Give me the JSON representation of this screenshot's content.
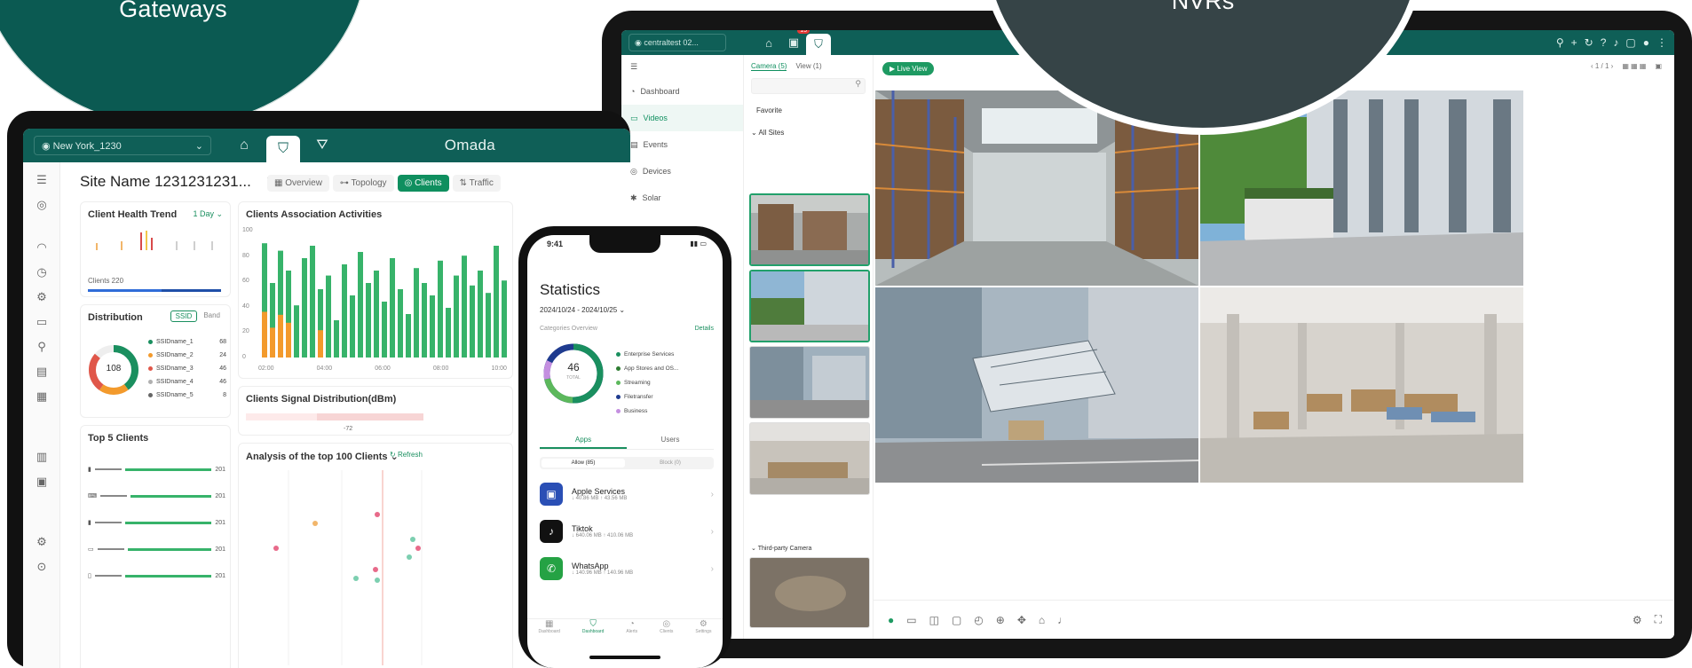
{
  "bubbles": {
    "gateways": "Gateways",
    "nvrs": "NVRs"
  },
  "omada": {
    "site_select": "New York_1230",
    "logo": "Omada",
    "site_name": "Site Name 1231231231...",
    "tabs": [
      "Overview",
      "Topology",
      "Clients",
      "Traffic"
    ],
    "active_tab": "Clients",
    "cards": {
      "health_title": "Client Health Trend",
      "health_range": "1 Day",
      "clients_summary": "Clients 220",
      "assoc_title": "Clients Association Activities",
      "assoc_yticks": [
        "100",
        "80",
        "60",
        "40",
        "20",
        "0"
      ],
      "assoc_xticks": [
        "02:00",
        "04:00",
        "06:00",
        "08:00",
        "10:00"
      ],
      "distribution_title": "Distribution",
      "dist_tabs": [
        "SSID",
        "Band"
      ],
      "donut_value": "108",
      "ssid_list": [
        {
          "name": "SSIDname_1",
          "value": "68"
        },
        {
          "name": "SSIDname_2",
          "value": "24"
        },
        {
          "name": "SSIDname_3",
          "value": "46"
        },
        {
          "name": "SSIDname_4",
          "value": "46"
        },
        {
          "name": "SSIDname_5",
          "value": "8"
        }
      ],
      "signal_title": "Clients Signal Distribution(dBm)",
      "signal_value": "-72",
      "top100_title": "Analysis of the top 100 Clients",
      "refresh": "Refresh",
      "top5_title": "Top 5 Clients",
      "top5_value": "201"
    }
  },
  "nvr": {
    "central_select": "centraltest 02...",
    "badge": "15",
    "sidebar": [
      "Dashboard",
      "Videos",
      "Events",
      "Devices",
      "Solar"
    ],
    "cam_tabs": [
      "Camera (5)",
      "View (1)"
    ],
    "favorite": "Favorite",
    "all_sites": "All Sites",
    "third_party": "Third-party Camera",
    "live_view": "Live View",
    "page": "1 / 1"
  },
  "phone": {
    "time": "9:41",
    "title": "Statistics",
    "range": "2024/10/24 - 2024/10/25",
    "categories": "Categories Overview",
    "details": "Details",
    "donut_value": "46",
    "donut_sub": "TOTAL",
    "legend": [
      {
        "label": "Enterprise Services",
        "color": "#1a8f5f"
      },
      {
        "label": "App Stores and OS...",
        "color": "#2e7d32"
      },
      {
        "label": "Streaming",
        "color": "#5cb85c"
      },
      {
        "label": "Filetransfer",
        "color": "#1f3b8f"
      },
      {
        "label": "Business",
        "color": "#c48fe0"
      }
    ],
    "seg_tabs": [
      "Apps",
      "Users"
    ],
    "filter_tabs": [
      "Allow (85)",
      "Block (0)"
    ],
    "apps": [
      {
        "name": "Apple Services",
        "down": "40.86 MB",
        "up": "43.56 MB"
      },
      {
        "name": "Tiktok",
        "down": "640.06 MB",
        "up": "410.06 MB"
      },
      {
        "name": "WhatsApp",
        "down": "140.96 MB",
        "up": "140.96 MB"
      }
    ],
    "bottom_nav": [
      "Dashboard",
      "Dashboard",
      "Alerts",
      "Clients",
      "Settings"
    ]
  }
}
